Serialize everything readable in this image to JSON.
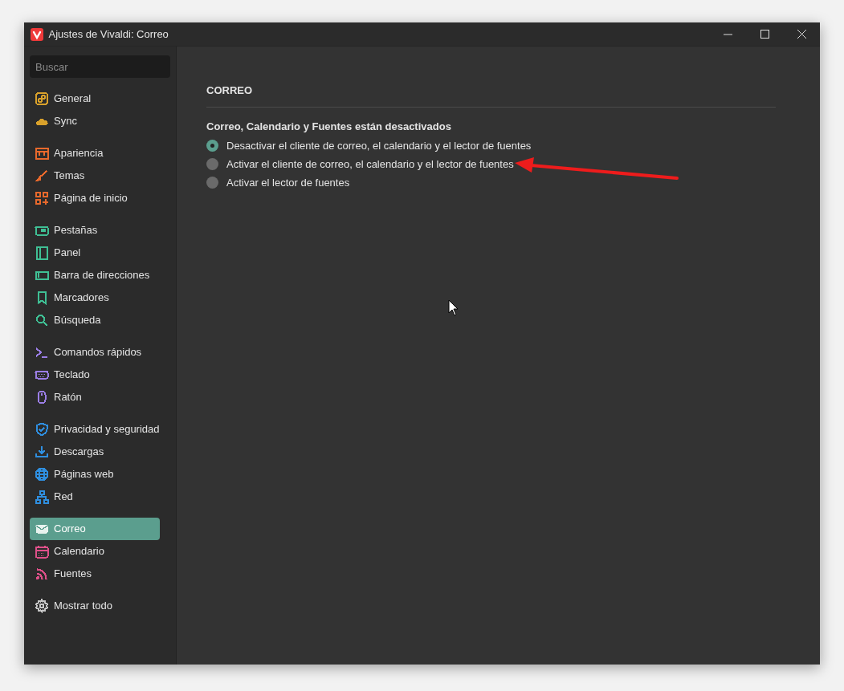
{
  "window": {
    "title": "Ajustes de Vivaldi: Correo"
  },
  "sidebar": {
    "search": {
      "placeholder": "Buscar"
    },
    "groups": [
      [
        {
          "label": "General",
          "color": "#d9a12b",
          "selected": false
        },
        {
          "label": "Sync",
          "color": "#d9a12b",
          "selected": false
        }
      ],
      [
        {
          "label": "Apariencia",
          "color": "#e8692c",
          "selected": false
        },
        {
          "label": "Temas",
          "color": "#e8692c",
          "selected": false
        },
        {
          "label": "Página de inicio",
          "color": "#e8692c",
          "selected": false
        }
      ],
      [
        {
          "label": "Pestañas",
          "color": "#3fbf94",
          "selected": false
        },
        {
          "label": "Panel",
          "color": "#3fbf94",
          "selected": false
        },
        {
          "label": "Barra de direcciones",
          "color": "#3fbf94",
          "selected": false
        },
        {
          "label": "Marcadores",
          "color": "#3fbf94",
          "selected": false
        },
        {
          "label": "Búsqueda",
          "color": "#3fbf94",
          "selected": false
        }
      ],
      [
        {
          "label": "Comandos rápidos",
          "color": "#9b7ee6",
          "selected": false
        },
        {
          "label": "Teclado",
          "color": "#9b7ee6",
          "selected": false
        },
        {
          "label": "Ratón",
          "color": "#9b7ee6",
          "selected": false
        }
      ],
      [
        {
          "label": "Privacidad y seguridad",
          "color": "#2f8fe0",
          "selected": false
        },
        {
          "label": "Descargas",
          "color": "#2f8fe0",
          "selected": false
        },
        {
          "label": "Páginas web",
          "color": "#2f8fe0",
          "selected": false
        },
        {
          "label": "Red",
          "color": "#2f8fe0",
          "selected": false
        }
      ],
      [
        {
          "label": "Correo",
          "color": "#e7f2ee",
          "selected": true
        },
        {
          "label": "Calendario",
          "color": "#e0508a",
          "selected": false
        },
        {
          "label": "Fuentes",
          "color": "#e0508a",
          "selected": false
        }
      ],
      [
        {
          "label": "Mostrar todo",
          "color": "#c8c8c8",
          "selected": false
        }
      ]
    ]
  },
  "main": {
    "heading": "CORREO",
    "subheading": "Correo, Calendario y Fuentes están desactivados",
    "options": [
      {
        "label": "Desactivar el cliente de correo, el calendario y el lector de fuentes",
        "selected": true
      },
      {
        "label": "Activar el cliente de correo, el calendario y el lector de fuentes",
        "selected": false
      },
      {
        "label": "Activar el lector de fuentes",
        "selected": false
      }
    ]
  }
}
